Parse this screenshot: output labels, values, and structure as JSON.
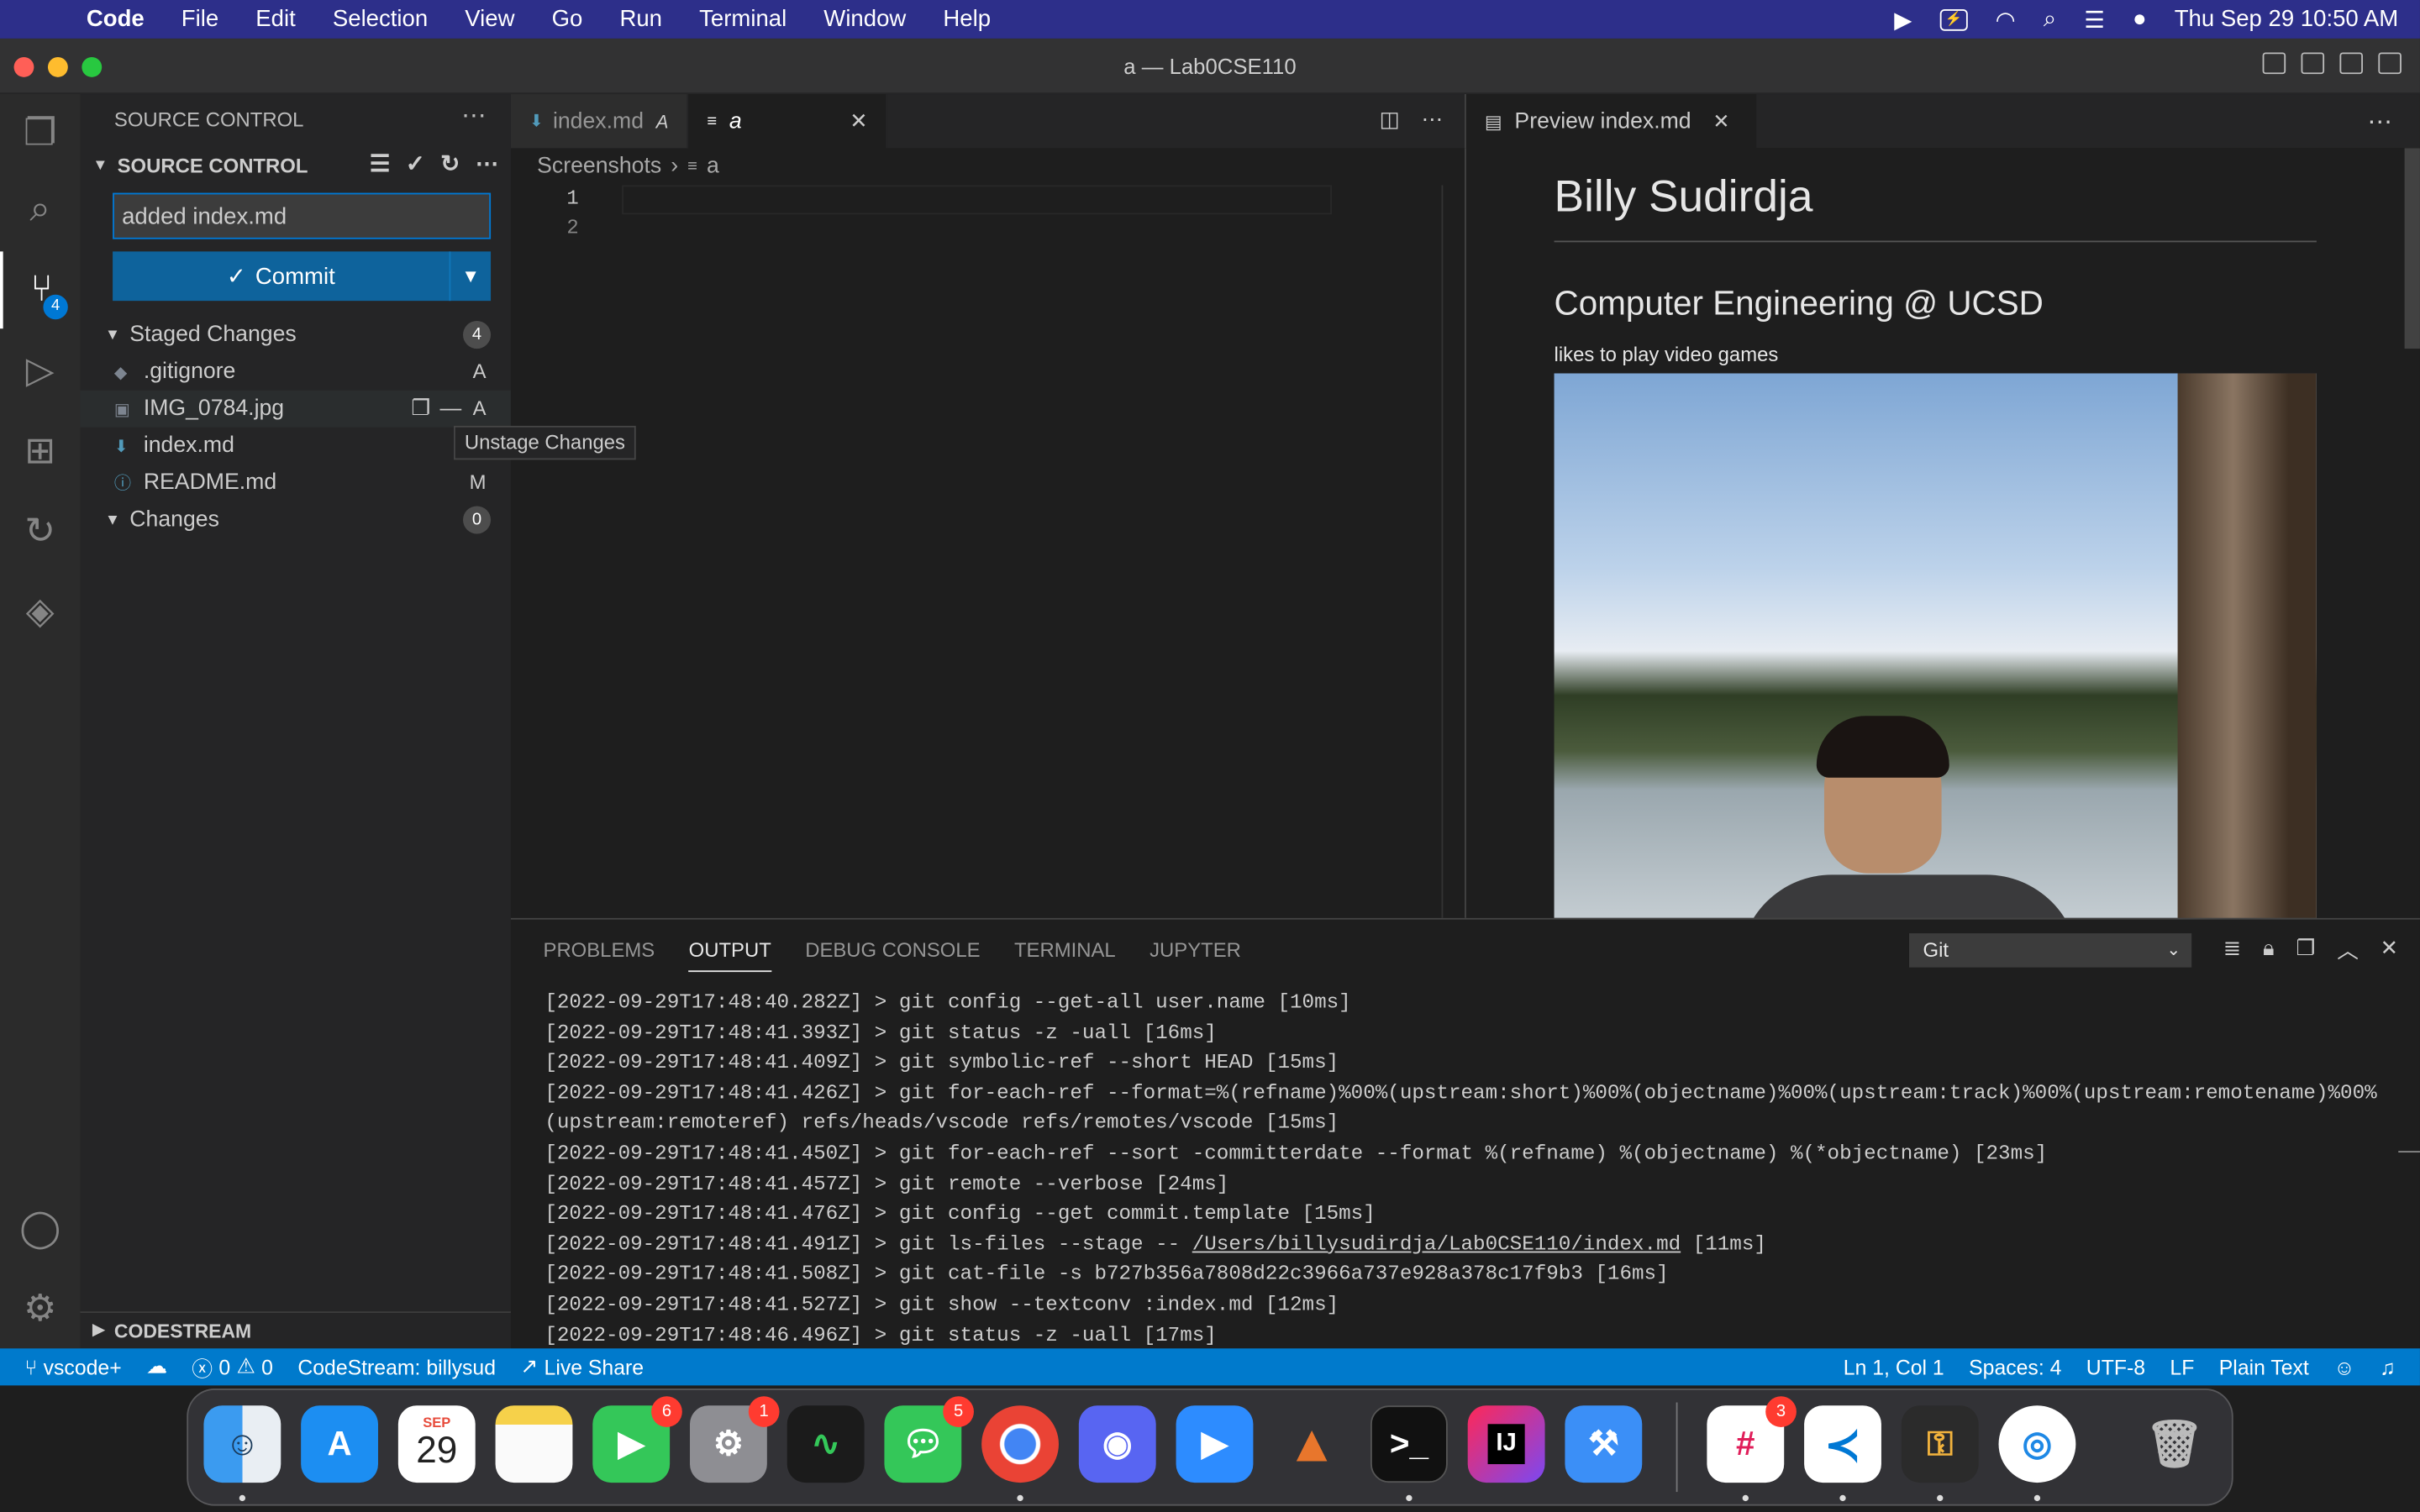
{
  "menubar": {
    "app": "Code",
    "items": [
      "File",
      "Edit",
      "Selection",
      "View",
      "Go",
      "Run",
      "Terminal",
      "Window",
      "Help"
    ],
    "clock": "Thu Sep 29  10:50 AM"
  },
  "window": {
    "title": "a — Lab0CSE110"
  },
  "activity": {
    "scm_badge": "4"
  },
  "sidebar": {
    "header": "SOURCE CONTROL",
    "section": "SOURCE CONTROL",
    "commit_message": "added index.md",
    "commit_label": "Commit",
    "staged": {
      "label": "Staged Changes",
      "count": "4",
      "files": [
        {
          "name": ".gitignore",
          "status": "A"
        },
        {
          "name": "IMG_0784.jpg",
          "status": "A"
        },
        {
          "name": "index.md",
          "status": ""
        },
        {
          "name": "README.md",
          "status": "M"
        }
      ]
    },
    "changes": {
      "label": "Changes",
      "count": "0"
    },
    "tooltip": "Unstage Changes",
    "codestream": "CODESTREAM"
  },
  "editor": {
    "tabs": [
      {
        "label": "index.md",
        "status": "A"
      },
      {
        "label": "a"
      }
    ],
    "breadcrumb": [
      "Screenshots",
      "a"
    ],
    "line_numbers": [
      "1",
      "2"
    ]
  },
  "preview": {
    "tab": "Preview index.md",
    "h1": "Billy Sudirdja",
    "h2": "Computer Engineering @ UCSD",
    "p": "likes to play video games"
  },
  "panel": {
    "tabs": [
      "PROBLEMS",
      "OUTPUT",
      "DEBUG CONSOLE",
      "TERMINAL",
      "JUPYTER"
    ],
    "active_tab": "OUTPUT",
    "channel": "Git",
    "log": [
      "[2022-09-29T17:48:40.282Z] > git config --get-all user.name [10ms]",
      "[2022-09-29T17:48:41.393Z] > git status -z -uall [16ms]",
      "[2022-09-29T17:48:41.409Z] > git symbolic-ref --short HEAD [15ms]",
      "[2022-09-29T17:48:41.426Z] > git for-each-ref --format=%(refname)%00%(upstream:short)%00%(objectname)%00%(upstream:track)%00%(upstream:remotename)%00%",
      "(upstream:remoteref) refs/heads/vscode refs/remotes/vscode [15ms]",
      "[2022-09-29T17:48:41.450Z] > git for-each-ref --sort -committerdate --format %(refname) %(objectname) %(*objectname) [23ms]",
      "[2022-09-29T17:48:41.457Z] > git remote --verbose [24ms]",
      "[2022-09-29T17:48:41.476Z] > git config --get commit.template [15ms]",
      "[2022-09-29T17:48:41.491Z] > git ls-files --stage -- ",
      "[2022-09-29T17:48:41.508Z] > git cat-file -s b727b356a7808d22c3966a737e928a378c17f9b3 [16ms]",
      "[2022-09-29T17:48:41.527Z] > git show --textconv :index.md [12ms]",
      "[2022-09-29T17:48:46.496Z] > git status -z -uall [17ms]"
    ],
    "log_link": "/Users/billysudirdja/Lab0CSE110/index.md",
    "log_link_suffix": " [11ms]"
  },
  "statusbar": {
    "branch": "vscode+",
    "errors": "0",
    "warnings": "0",
    "codestream": "CodeStream: billysud",
    "liveshare": "Live Share",
    "position": "Ln 1, Col 1",
    "spaces": "Spaces: 4",
    "encoding": "UTF-8",
    "eol": "LF",
    "language": "Plain Text"
  },
  "dock": {
    "calendar_month": "SEP",
    "calendar_day": "29",
    "badges": {
      "facetime": "6",
      "settings": "1",
      "messages": "5",
      "slack": "3"
    },
    "intellij_label": "IJ"
  },
  "colors": {
    "accent": "#007acc",
    "commit_button": "#0e639c",
    "menubar": "#2d2f8a"
  }
}
